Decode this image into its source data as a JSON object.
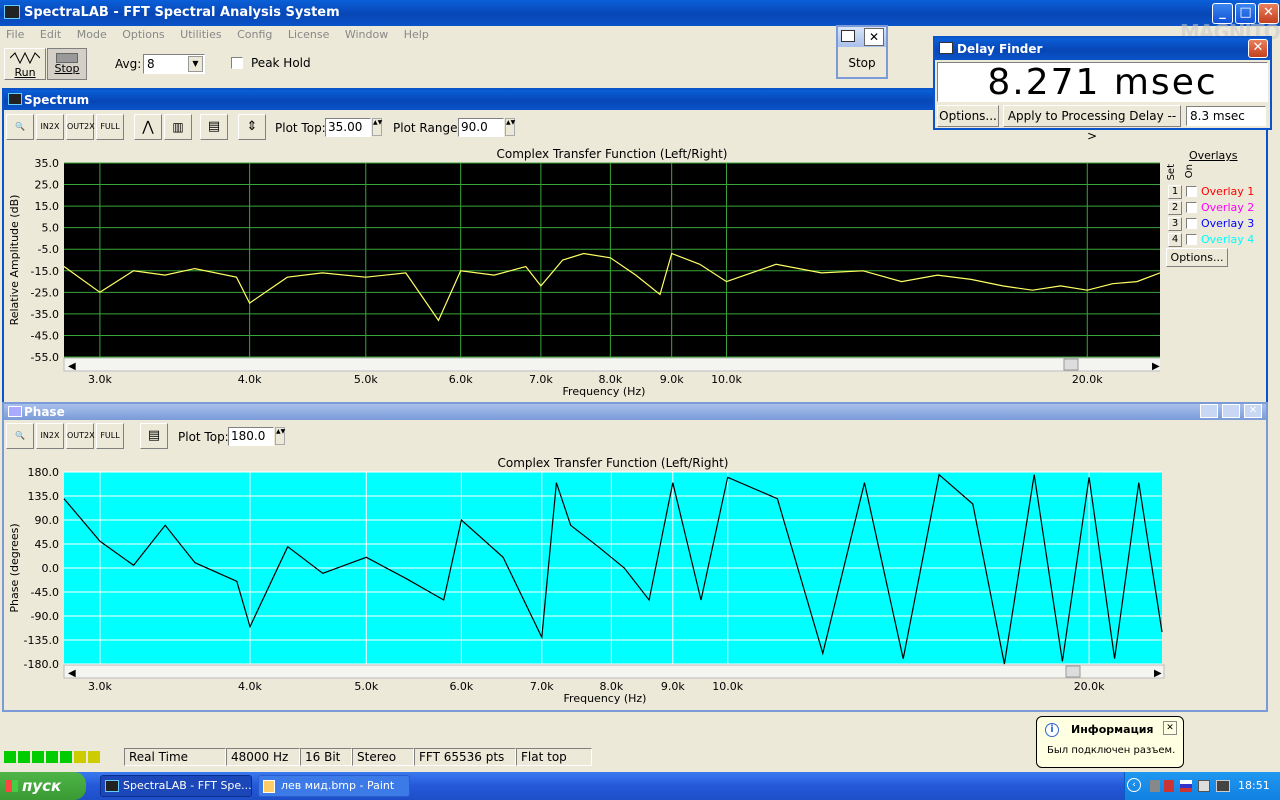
{
  "window": {
    "title": "SpectraLAB - FFT Spectral Analysis System"
  },
  "menu": [
    "File",
    "Edit",
    "Mode",
    "Options",
    "Utilities",
    "Config",
    "License",
    "Window",
    "Help"
  ],
  "toolbar": {
    "run": "Run",
    "stop": "Stop",
    "avg_label": "Avg:",
    "avg_value": "8",
    "peak_hold": "Peak Hold"
  },
  "stop_window": {
    "label": "Stop"
  },
  "delay_finder": {
    "title": "Delay Finder",
    "value": "8.271 msec",
    "options": "Options...",
    "apply": "Apply to Processing Delay -->",
    "delay_value": "8.3 msec"
  },
  "watermark": "MAGNITOLA",
  "spectrum": {
    "title": "Spectrum",
    "plot_top_label": "Plot Top:",
    "plot_top": "35.00",
    "plot_range_label": "Plot Range:",
    "plot_range": "90.0",
    "chart_title": "Complex Transfer Function (Left/Right)",
    "ylabel": "Relative Amplitude (dB)",
    "xlabel": "Frequency (Hz)",
    "yticks": [
      "35.0",
      "25.0",
      "15.0",
      "5.0",
      "-5.0",
      "-15.0",
      "-25.0",
      "-35.0",
      "-45.0",
      "-55.0"
    ],
    "xticks": [
      "3.0k",
      "4.0k",
      "5.0k",
      "6.0k",
      "7.0k",
      "8.0k",
      "9.0k",
      "10.0k",
      "20.0k"
    ],
    "overlays_label": "Overlays",
    "set_label": "Set",
    "on_label": "On",
    "overlays": [
      {
        "num": "1",
        "name": "Overlay 1",
        "color": "#ff0000"
      },
      {
        "num": "2",
        "name": "Overlay 2",
        "color": "#ff00ff"
      },
      {
        "num": "3",
        "name": "Overlay 3",
        "color": "#0000ff"
      },
      {
        "num": "4",
        "name": "Overlay 4",
        "color": "#00ffff"
      }
    ],
    "overlay_options": "Options..."
  },
  "phase": {
    "title": "Phase",
    "plot_top_label": "Plot Top:",
    "plot_top": "180.0",
    "chart_title": "Complex Transfer Function (Left/Right)",
    "ylabel": "Phase (degrees)",
    "xlabel": "Frequency (Hz)",
    "yticks": [
      "180.0",
      "135.0",
      "90.0",
      "45.0",
      "0.0",
      "-45.0",
      "-90.0",
      "-135.0",
      "-180.0"
    ],
    "xticks": [
      "3.0k",
      "4.0k",
      "5.0k",
      "6.0k",
      "7.0k",
      "8.0k",
      "9.0k",
      "10.0k",
      "20.0k"
    ]
  },
  "status": {
    "mode": "Real Time",
    "rate": "48000 Hz",
    "bits": "16 Bit",
    "channels": "Stereo",
    "fft": "FFT 65536 pts",
    "window": "Flat top"
  },
  "balloon": {
    "title": "Информация",
    "text": "Был подключен разъем."
  },
  "taskbar": {
    "start": "пуск",
    "items": [
      "SpectraLAB - FFT Spe...",
      "лев мид.bmp - Paint"
    ],
    "clock": "18:51"
  },
  "chart_data": [
    {
      "type": "line",
      "title": "Complex Transfer Function (Left/Right)",
      "xlabel": "Frequency (Hz)",
      "ylabel": "Relative Amplitude (dB)",
      "ylim": [
        -55,
        35
      ],
      "xscale": "log",
      "series": [
        {
          "color": "#ffff66",
          "x": [
            2800,
            3000,
            3200,
            3400,
            3600,
            3900,
            4000,
            4300,
            4600,
            5000,
            5400,
            5750,
            6000,
            6400,
            6800,
            7000,
            7300,
            7600,
            8000,
            8400,
            8800,
            9000,
            9500,
            10000,
            11000,
            12000,
            13000,
            14000,
            15000,
            16000,
            17000,
            18000,
            19000,
            20000,
            21000,
            22000,
            23000
          ],
          "values": [
            -13,
            -25,
            -15,
            -17,
            -14,
            -18,
            -30,
            -18,
            -16,
            -18,
            -16,
            -38,
            -15,
            -17,
            -13,
            -22,
            -10,
            -7,
            -9,
            -17,
            -26,
            -7,
            -12,
            -20,
            -12,
            -16,
            -15,
            -20,
            -17,
            -19,
            -22,
            -24,
            -22,
            -24,
            -21,
            -20,
            -16
          ]
        }
      ],
      "grid": true
    },
    {
      "type": "line",
      "title": "Complex Transfer Function (Left/Right)",
      "xlabel": "Frequency (Hz)",
      "ylabel": "Phase (degrees)",
      "ylim": [
        -180,
        180
      ],
      "xscale": "log",
      "series": [
        {
          "color": "#000000",
          "x": [
            2800,
            3000,
            3200,
            3400,
            3600,
            3900,
            4000,
            4300,
            4600,
            5000,
            5400,
            5800,
            6000,
            6500,
            7000,
            7200,
            7400,
            7800,
            8200,
            8600,
            9000,
            9500,
            10000,
            11000,
            12000,
            13000,
            14000,
            15000,
            16000,
            17000,
            18000,
            19000,
            20000,
            21000,
            22000,
            23000
          ],
          "values": [
            130,
            50,
            5,
            80,
            10,
            -25,
            -110,
            40,
            -10,
            20,
            -20,
            -60,
            90,
            20,
            -130,
            160,
            80,
            40,
            0,
            -60,
            160,
            -60,
            170,
            130,
            -160,
            160,
            -170,
            175,
            120,
            -180,
            175,
            -175,
            170,
            -170,
            160,
            -120
          ]
        }
      ],
      "grid": true
    }
  ]
}
